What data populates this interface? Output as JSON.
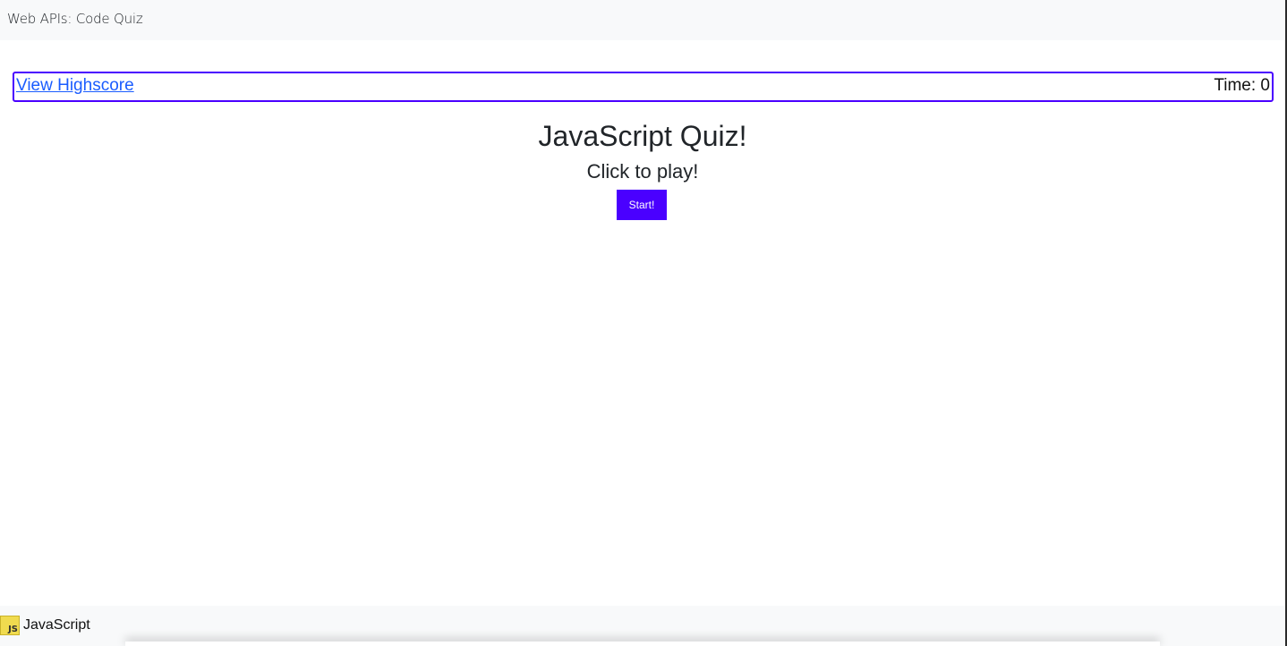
{
  "navbar": {
    "brand": "Web APIs: Code Quiz"
  },
  "header": {
    "highscore_link": "View Highscore",
    "timer_label": "Time: ",
    "timer_value": "0"
  },
  "main": {
    "title": "JavaScript Quiz!",
    "subtitle": "Click to play!",
    "start_label": "Start!"
  },
  "footer": {
    "logo_text": "JS",
    "label": "JavaScript"
  },
  "colors": {
    "accent": "#4a00ff",
    "link": "#1a5cff",
    "bar_background": "#f8f9fa",
    "js_yellow": "#f0db4f"
  },
  "icons": {
    "footer_logo": "javascript-logo-icon"
  }
}
